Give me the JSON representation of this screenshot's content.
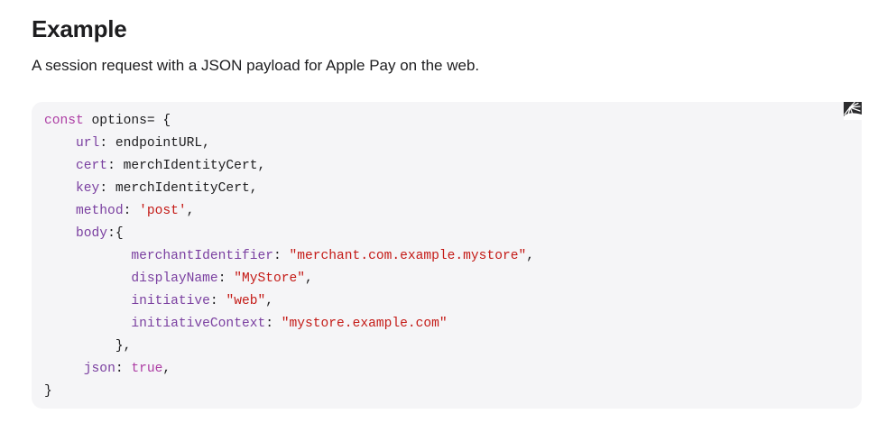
{
  "section": {
    "heading": "Example",
    "description": "A session request with a JSON payload for Apple Pay on the web."
  },
  "code_block": {
    "copy_icon": "copy-code-icon",
    "colors": {
      "background": "#f5f5f7",
      "keyword": "#ad3da4",
      "property": "#7a3fa0",
      "string": "#c41a16",
      "plain": "#1d1d1f"
    },
    "lines": [
      [
        {
          "t": "kw",
          "text": "const"
        },
        {
          "t": "plain",
          "text": " options= {"
        }
      ],
      [
        {
          "t": "plain",
          "text": "    "
        },
        {
          "t": "prop",
          "text": "url"
        },
        {
          "t": "plain",
          "text": ": endpointURL,"
        }
      ],
      [
        {
          "t": "plain",
          "text": "    "
        },
        {
          "t": "prop",
          "text": "cert"
        },
        {
          "t": "plain",
          "text": ": merchIdentityCert,"
        }
      ],
      [
        {
          "t": "plain",
          "text": "    "
        },
        {
          "t": "prop",
          "text": "key"
        },
        {
          "t": "plain",
          "text": ": merchIdentityCert,"
        }
      ],
      [
        {
          "t": "plain",
          "text": "    "
        },
        {
          "t": "prop",
          "text": "method"
        },
        {
          "t": "plain",
          "text": ": "
        },
        {
          "t": "str",
          "text": "'post'"
        },
        {
          "t": "plain",
          "text": ","
        }
      ],
      [
        {
          "t": "plain",
          "text": "    "
        },
        {
          "t": "prop",
          "text": "body"
        },
        {
          "t": "plain",
          "text": ":{"
        }
      ],
      [
        {
          "t": "plain",
          "text": "           "
        },
        {
          "t": "prop",
          "text": "merchantIdentifier"
        },
        {
          "t": "plain",
          "text": ": "
        },
        {
          "t": "str",
          "text": "\"merchant.com.example.mystore\""
        },
        {
          "t": "plain",
          "text": ","
        }
      ],
      [
        {
          "t": "plain",
          "text": "           "
        },
        {
          "t": "prop",
          "text": "displayName"
        },
        {
          "t": "plain",
          "text": ": "
        },
        {
          "t": "str",
          "text": "\"MyStore\""
        },
        {
          "t": "plain",
          "text": ","
        }
      ],
      [
        {
          "t": "plain",
          "text": "           "
        },
        {
          "t": "prop",
          "text": "initiative"
        },
        {
          "t": "plain",
          "text": ": "
        },
        {
          "t": "str",
          "text": "\"web\""
        },
        {
          "t": "plain",
          "text": ","
        }
      ],
      [
        {
          "t": "plain",
          "text": "           "
        },
        {
          "t": "prop",
          "text": "initiativeContext"
        },
        {
          "t": "plain",
          "text": ": "
        },
        {
          "t": "str",
          "text": "\"mystore.example.com\""
        }
      ],
      [
        {
          "t": "plain",
          "text": "         },"
        }
      ],
      [
        {
          "t": "plain",
          "text": "     "
        },
        {
          "t": "prop",
          "text": "json"
        },
        {
          "t": "plain",
          "text": ": "
        },
        {
          "t": "kw",
          "text": "true"
        },
        {
          "t": "plain",
          "text": ","
        }
      ],
      [
        {
          "t": "plain",
          "text": "}"
        }
      ]
    ]
  }
}
